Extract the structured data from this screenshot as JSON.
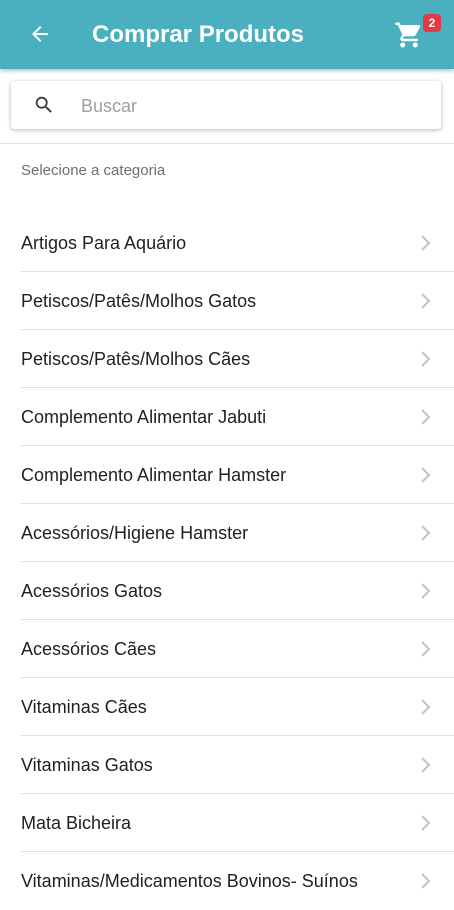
{
  "header": {
    "title": "Comprar Produtos",
    "back_icon": "arrow-left-icon",
    "cart_icon": "shopping-cart-icon",
    "cart_count": "2",
    "bar_color": "#4aafbf",
    "badge_color": "#e53946"
  },
  "search": {
    "placeholder": "Buscar",
    "value": "",
    "icon": "search-icon"
  },
  "section_label": "Selecione a categoria",
  "categories": [
    {
      "label": "Artigos Para Aquário"
    },
    {
      "label": "Petiscos/Patês/Molhos Gatos"
    },
    {
      "label": "Petiscos/Patês/Molhos Cães"
    },
    {
      "label": "Complemento Alimentar Jabuti"
    },
    {
      "label": "Complemento Alimentar Hamster"
    },
    {
      "label": "Acessórios/Higiene Hamster"
    },
    {
      "label": "Acessórios Gatos"
    },
    {
      "label": "Acessórios Cães"
    },
    {
      "label": "Vitaminas Cães"
    },
    {
      "label": "Vitaminas Gatos"
    },
    {
      "label": "Mata Bicheira"
    },
    {
      "label": "Vitaminas/Medicamentos Bovinos- Suínos"
    }
  ]
}
